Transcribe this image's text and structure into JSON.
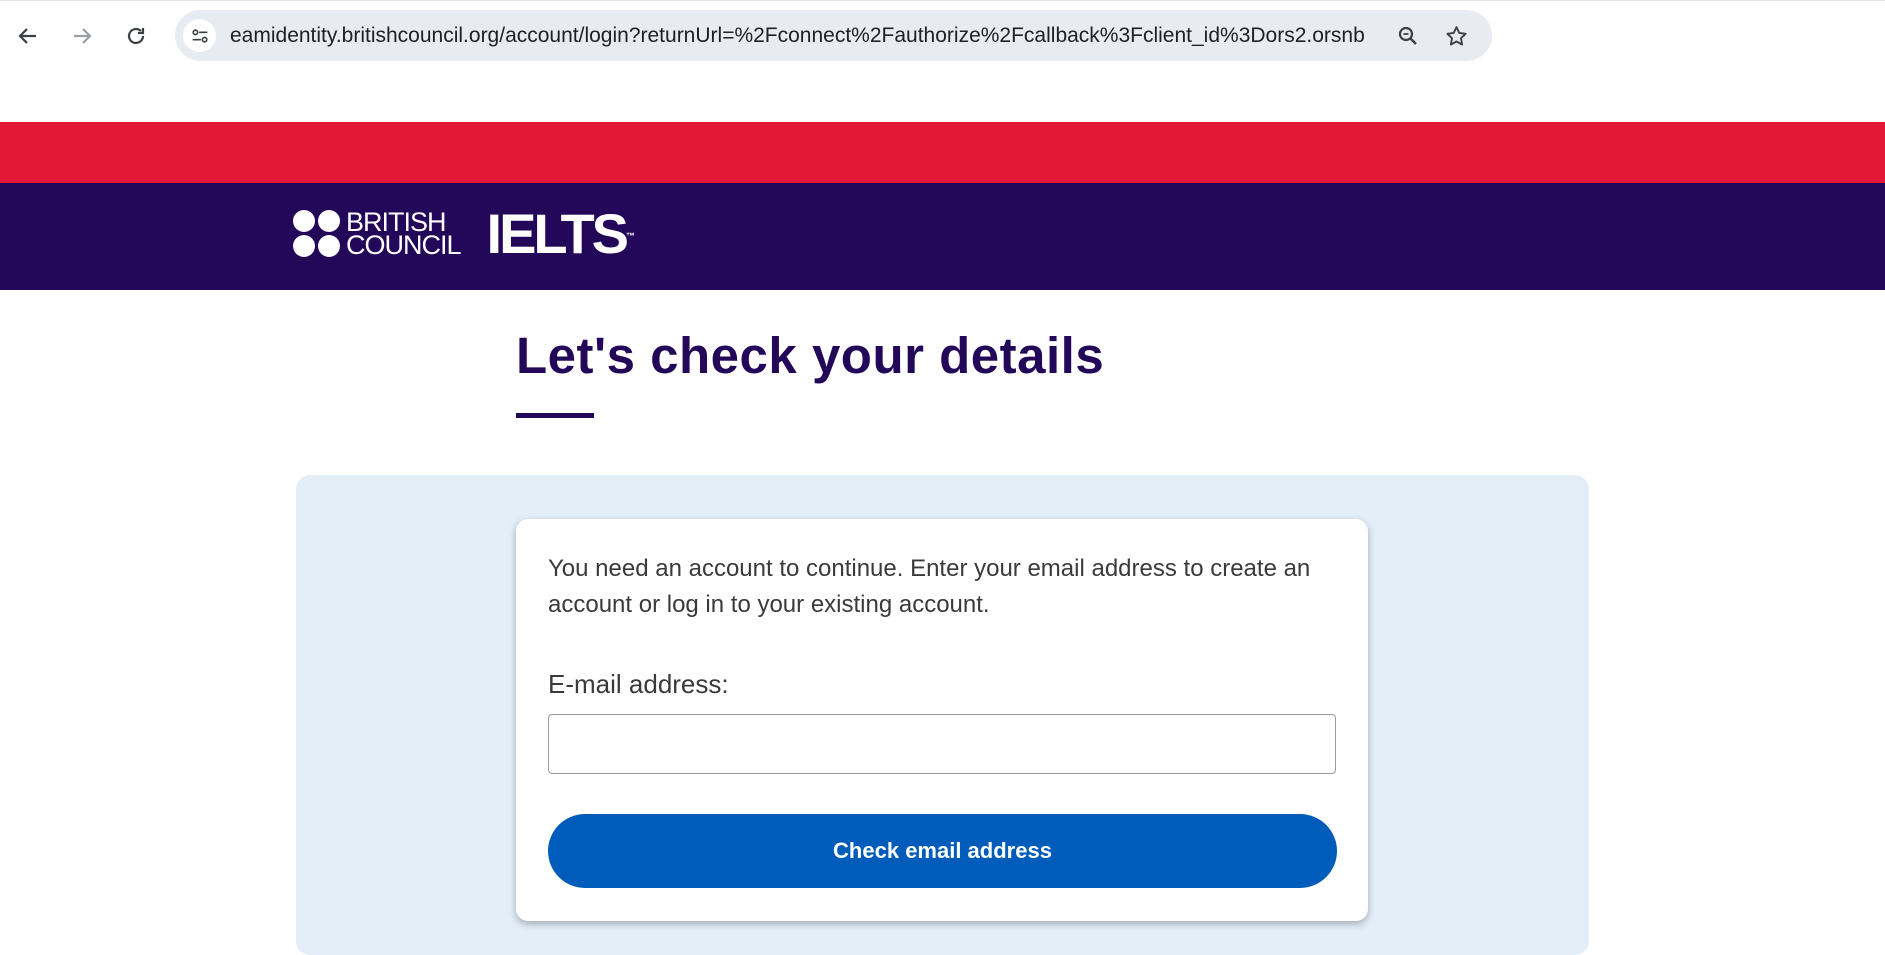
{
  "browser": {
    "url": "eamidentity.britishcouncil.org/account/login?returnUrl=%2Fconnect%2Fauthorize%2Fcallback%3Fclient_id%3Dors2.orsnb...",
    "icons": [
      "back-arrow-icon",
      "forward-arrow-icon",
      "reload-icon",
      "site-info-icon",
      "zoom-icon",
      "bookmark-star-icon"
    ]
  },
  "brand": {
    "council_line1": "BRITISH",
    "council_line2": "COUNCIL",
    "product": "IELTS",
    "trademark": "™"
  },
  "page": {
    "title": "Let's check your details"
  },
  "form": {
    "intro": "You need an account to continue. Enter your email address to create an account or log in to your existing account.",
    "email_label": "E-mail address:",
    "email_value": "",
    "submit_label": "Check email address"
  },
  "colors": {
    "red_band": "#e31837",
    "purple_band": "#23085a",
    "panel_bg": "#e3eef8",
    "button": "#005cbb"
  }
}
